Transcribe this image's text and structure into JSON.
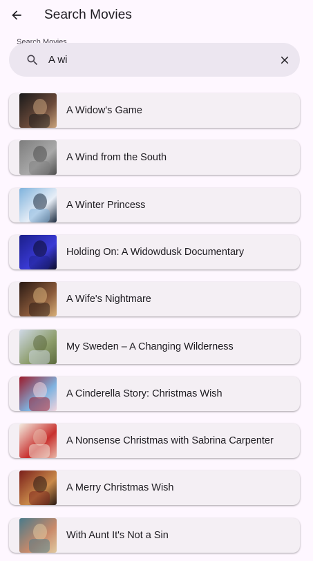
{
  "appbar": {
    "title": "Search Movies",
    "back_icon": "arrow-back-icon"
  },
  "search": {
    "label": "Search Movies",
    "value": "A wi",
    "search_icon": "search-icon",
    "clear_icon": "close-icon"
  },
  "results": [
    {
      "title": "A Widow's Game",
      "poster_colors": [
        "#1a1a1a",
        "#6b4a3a",
        "#c9a37c"
      ]
    },
    {
      "title": "A Wind from the South",
      "poster_colors": [
        "#7d7d7d",
        "#a9a9a9",
        "#4f4f4f"
      ]
    },
    {
      "title": "A Winter Princess",
      "poster_colors": [
        "#7fb2dc",
        "#e7eef7",
        "#1c2b3f"
      ]
    },
    {
      "title": "Holding On: A Widowdusk Documentary",
      "poster_colors": [
        "#1b1f8a",
        "#3a3ad6",
        "#0b0b2a"
      ]
    },
    {
      "title": "A Wife's Nightmare",
      "poster_colors": [
        "#2a1a14",
        "#8a5a3a",
        "#d8b07a"
      ]
    },
    {
      "title": "My Sweden – A Changing Wilderness",
      "poster_colors": [
        "#cfd9e6",
        "#8c9c6a",
        "#5c6a3e"
      ]
    },
    {
      "title": "A Cinderella Story: Christmas Wish",
      "poster_colors": [
        "#9c1a2a",
        "#7fb3e0",
        "#f1d3dc"
      ]
    },
    {
      "title": "A Nonsense Christmas with Sabrina Carpenter",
      "poster_colors": [
        "#f3ece0",
        "#c8302e",
        "#e8b8a8"
      ]
    },
    {
      "title": "A Merry Christmas Wish",
      "poster_colors": [
        "#7a1f1a",
        "#c98a4a",
        "#2a1a14"
      ]
    },
    {
      "title": "With Aunt It's Not a Sin",
      "poster_colors": [
        "#4a7a8a",
        "#c98a6a",
        "#e0c9a0"
      ]
    }
  ],
  "colors": {
    "background": "#FEF7FF",
    "search_bar": "#ECE6F0",
    "card": "#F4EFF4",
    "text": "#1D1B20"
  }
}
